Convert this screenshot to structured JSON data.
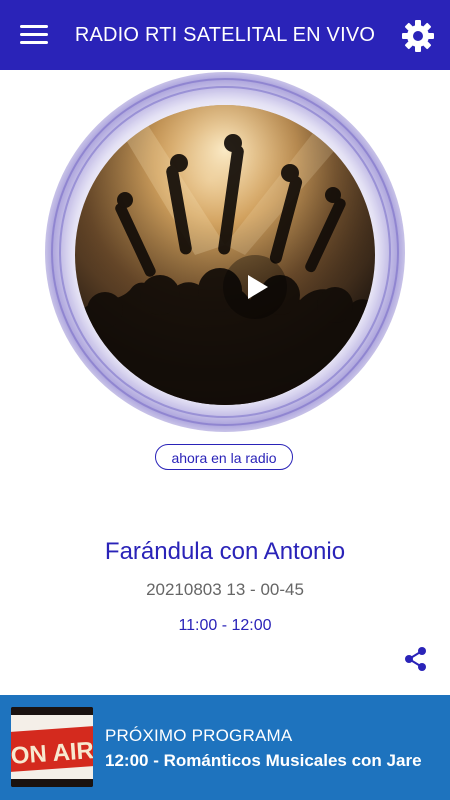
{
  "header": {
    "title": "RADIO RTI SATELITAL EN VIVO",
    "menu_icon": "hamburger-menu-icon",
    "settings_icon": "gear-icon"
  },
  "player": {
    "now_label": "ahora en la radio",
    "play_icon": "play-icon"
  },
  "program": {
    "title": "Farándula con Antonio",
    "subtitle": "20210803 13 - 00-45",
    "time": "11:00 - 12:00",
    "share_icon": "share-icon"
  },
  "next": {
    "label": "PRÓXIMO PROGRAMA",
    "show": "12:00 - Románticos Musicales con Jare",
    "thumb_text": "ON AIR"
  },
  "colors": {
    "primary": "#2a23b8",
    "bottom_bar": "#1e73be",
    "subtitle_gray": "#666666"
  }
}
